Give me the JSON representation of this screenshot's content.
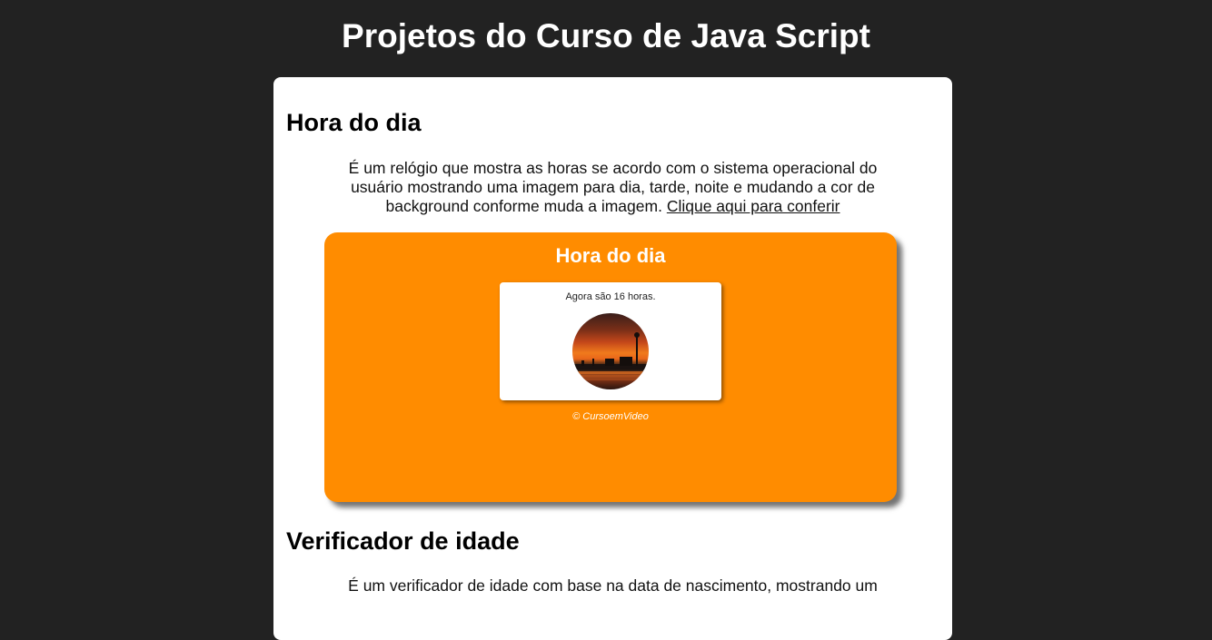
{
  "page": {
    "title": "Projetos do Curso de Java Script"
  },
  "projects": [
    {
      "title": "Hora do dia",
      "description": "É um relógio que mostra as horas se acordo com o sistema operacional do usuário mostrando uma imagem para dia, tarde, noite e mudando a cor de background conforme muda a imagem.",
      "link_text": "Clique aqui para conferir",
      "preview": {
        "title": "Hora do dia",
        "clock_text": "Agora são 16 horas.",
        "footer": "© CursoemVideo",
        "background_color": "#ff8c00",
        "image_icon": "sunset-photo"
      }
    },
    {
      "title": "Verificador de idade",
      "description": "É um verificador de idade com base na data de nascimento, mostrando um"
    }
  ],
  "colors": {
    "page_background": "#222222",
    "card_background": "#ffffff",
    "accent": "#ff8c00"
  }
}
